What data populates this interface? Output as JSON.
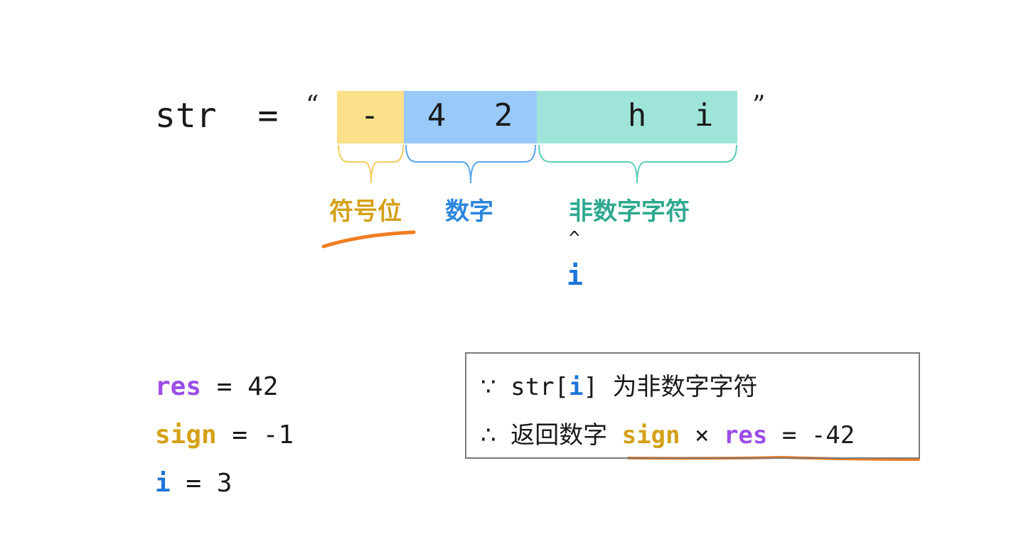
{
  "assignment": {
    "var": "str",
    "eq": "=",
    "open_quote": "“",
    "close_quote": "”"
  },
  "chars": {
    "sign": "-",
    "d1": "4",
    "d2": "2",
    "c1": "h",
    "c2": "i"
  },
  "groups": {
    "sign": "符号位",
    "digits": "数字",
    "nondigit": "非数字字符"
  },
  "pointer": {
    "caret": "^",
    "label": "i"
  },
  "variables": [
    {
      "name": "res",
      "eq": "=",
      "value": "42"
    },
    {
      "name": "sign",
      "eq": "=",
      "value": "-1"
    },
    {
      "name": "i",
      "eq": "=",
      "value": "3"
    }
  ],
  "reasoning": {
    "because": "∵",
    "str_prefix": "str[",
    "index": "i",
    "str_suffix": "]",
    "cond_text": "为非数字字符",
    "therefore": "∴",
    "result_text": "返回数字",
    "sign": "sign",
    "times": "×",
    "res": "res",
    "eq": "=",
    "result": "-42"
  },
  "colors": {
    "sign": "#d4a017",
    "digits": "#2b86df",
    "nondigit": "#2fa890",
    "res": "#9b4de8",
    "index": "#1c74d8",
    "underline": "#f07d22"
  }
}
